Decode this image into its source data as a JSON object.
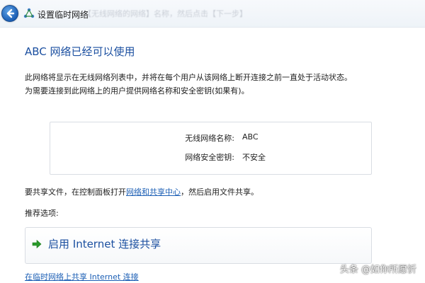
{
  "window": {
    "title": "设置临时网络",
    "background_text": "【无线网络的网络】名称，然后点击【下一步】"
  },
  "main": {
    "heading": "ABC 网络已经可以使用",
    "description": "此网络将显示在无线网络列表中，并将在每个用户从该网络上断开连接之前一直处于活动状态。为需要连接到此网络上的用户提供网络名称和安全密钥(如果有)。",
    "info": {
      "network_name_label": "无线网络名称:",
      "network_name_value": "ABC",
      "security_key_label": "网络安全密钥:",
      "security_key_value": "不安全"
    },
    "share": {
      "prefix": "要共享文件，在控制面板打开",
      "link": "网络和共享中心",
      "suffix": "，然后启用文件共享。"
    },
    "recommended_label": "推荐选项:",
    "option": {
      "label": "启用 Internet 连接共享",
      "icon": "green-arrow-icon"
    },
    "bottom_link": "在临时网络上共享 Internet 连接"
  },
  "watermark": {
    "credit": "头条 @如你所愿忻"
  },
  "colors": {
    "heading": "#1b4fa0",
    "link": "#1c5fb5",
    "arrow": "#2a9a2a"
  }
}
